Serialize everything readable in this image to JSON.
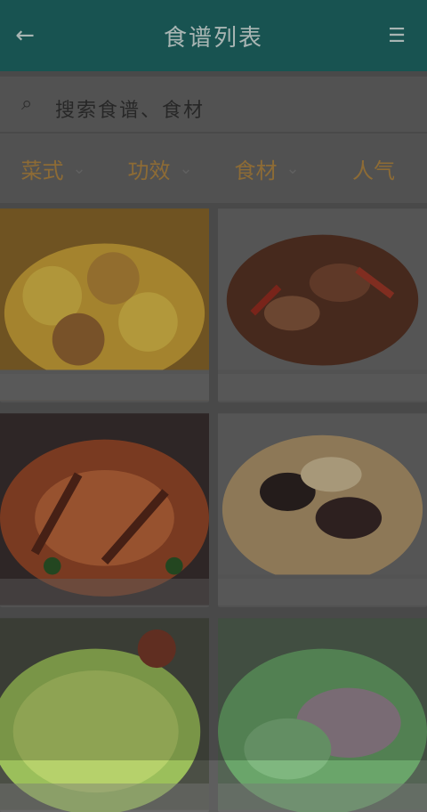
{
  "appbar": {
    "back_icon": "←",
    "title": "食谱列表",
    "menu_icon": "☰"
  },
  "search": {
    "icon": "⌕",
    "text": "搜索食谱、食材"
  },
  "filters": [
    {
      "label": "菜式",
      "chev": "⌄"
    },
    {
      "label": "功效",
      "chev": "⌄"
    },
    {
      "label": "食材",
      "chev": "⌄"
    },
    {
      "label": "人气",
      "chev": ""
    }
  ],
  "recipes": [
    {
      "name": ""
    },
    {
      "name": ""
    },
    {
      "name": ""
    },
    {
      "name": ""
    },
    {
      "name": ""
    },
    {
      "name": ""
    }
  ]
}
